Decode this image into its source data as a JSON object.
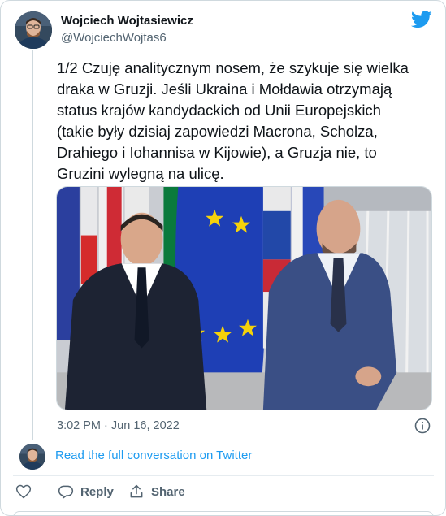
{
  "tweet": {
    "author_name": "Wojciech Wojtasiewicz",
    "author_handle": "@WojciechWojtas6",
    "text": "1/2 Czuję analitycznym nosem, że szykuje się wielka\ndraka w Gruzji. Jeśli Ukraina i Mołdawia otrzymają\nstatus krajów kandydackich od Unii Europejskich\n(takie były dzisiaj zapowiedzi Macrona, Scholza,\nDrahiego i Iohannisa w Kijowie), a Gruzja nie, to\nGruzini wylegną na ulicę.",
    "time": "3:02 PM",
    "separator": "·",
    "date": "Jun 16, 2022"
  },
  "footer": {
    "read_link": "Read the full conversation on Twitter",
    "reply_label": "Reply",
    "share_label": "Share"
  },
  "icons": {
    "logo": "twitter-bird-icon",
    "info": "info-icon",
    "like": "heart-icon",
    "reply": "reply-bubble-icon",
    "share": "share-icon"
  },
  "colors": {
    "accent": "#1d9bf0",
    "text": "#0f1419",
    "muted": "#536471",
    "border": "#cfd9de"
  }
}
